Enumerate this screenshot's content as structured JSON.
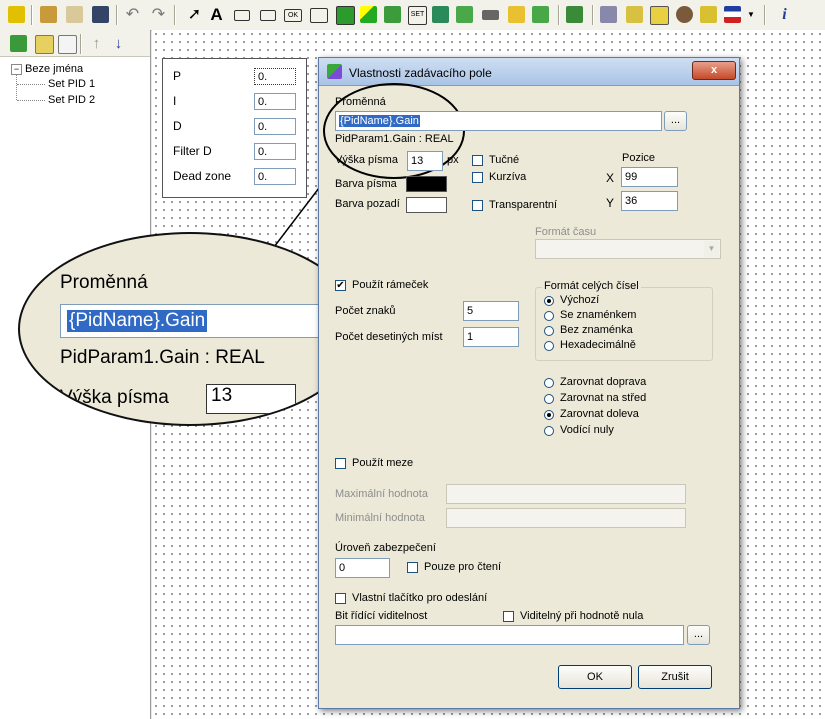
{
  "toolbar": {
    "icons": [
      "pen-icon",
      "people-icon",
      "search-person-icon",
      "save-icon",
      "undo-icon",
      "redo-icon",
      "pointer-icon",
      "text-icon",
      "value-field-icon",
      "input-field-icon",
      "ok-button-icon",
      "rectangle-icon",
      "green-box-icon",
      "bar-icon",
      "window-icon",
      "set-button-icon",
      "image-icon",
      "film-icon",
      "camera-icon",
      "upload-icon",
      "download-icon",
      "layers-icon",
      "stack-icon",
      "book-icon",
      "checklist-icon",
      "gear-icon",
      "brush-icon",
      "flag-icon",
      "dropdown-icon",
      "info-icon"
    ],
    "text_A": "A",
    "ok_small": "OK",
    "set_small": "SET",
    "info": "i"
  },
  "left_toolbar": {
    "icons": [
      "new-folder-icon",
      "new-page-icon",
      "delete-page-icon",
      "move-up-icon",
      "move-down-icon"
    ]
  },
  "tree": {
    "root": "Beze jména",
    "expander": "−",
    "items": [
      "Set PID 1",
      "Set PID 2"
    ]
  },
  "pid_panel": {
    "rows": [
      {
        "label": "P",
        "value": "0."
      },
      {
        "label": "I",
        "value": "0."
      },
      {
        "label": "D",
        "value": "0."
      },
      {
        "label": "Filter D",
        "value": "0."
      },
      {
        "label": "Dead zone",
        "value": "0."
      }
    ]
  },
  "magnifier": {
    "label": "Proměnná",
    "value": "{PidName}.Gain",
    "type_text": "PidParam1.Gain : REAL",
    "font_label": "Výška písma",
    "font_value": "13"
  },
  "dialog": {
    "title": "Vlastnosti zadávacího pole",
    "close": "x",
    "variable_label": "Proměnná",
    "variable_value": "{PidName}.Gain",
    "browse": "...",
    "type_text": "PidParam1.Gain : REAL",
    "font_height_label": "Výška písma",
    "font_height_value": "13",
    "px": "px",
    "bold": "Tučné",
    "italic": "Kurzíva",
    "position_label": "Pozice",
    "x_label": "X",
    "x_value": "99",
    "y_label": "Y",
    "y_value": "36",
    "font_color_label": "Barva písma",
    "font_color": "#000000",
    "bg_color_label": "Barva pozadí",
    "bg_color": "#ffffff",
    "transparent": "Transparentní",
    "time_format_label": "Formát času",
    "use_frame": "Použít rámeček",
    "use_frame_checked": "✔",
    "char_count_label": "Počet znaků",
    "char_count_value": "5",
    "decimals_label": "Počet desetiných míst",
    "decimals_value": "1",
    "int_format_label": "Formát celých čísel",
    "int_format_options": [
      "Výchozí",
      "Se znaménkem",
      "Bez znaménka",
      "Hexadecimálně"
    ],
    "int_format_selected": "Výchozí",
    "align_options": [
      "Zarovnat doprava",
      "Zarovnat na střed",
      "Zarovnat doleva",
      "Vodící nuly"
    ],
    "align_selected": "Zarovnat doleva",
    "use_limits": "Použít meze",
    "max_label": "Maximální hodnota",
    "min_label": "Minimální hodnota",
    "security_label": "Úroveň zabezpečení",
    "security_value": "0",
    "readonly": "Pouze pro čtení",
    "custom_send": "Vlastní tlačítko pro odeslání",
    "visibility_bit_label": "Bit řídící viditelnost",
    "visible_zero": "Viditelný při hodnotě nula",
    "ok": "OK",
    "cancel": "Zrušit"
  }
}
